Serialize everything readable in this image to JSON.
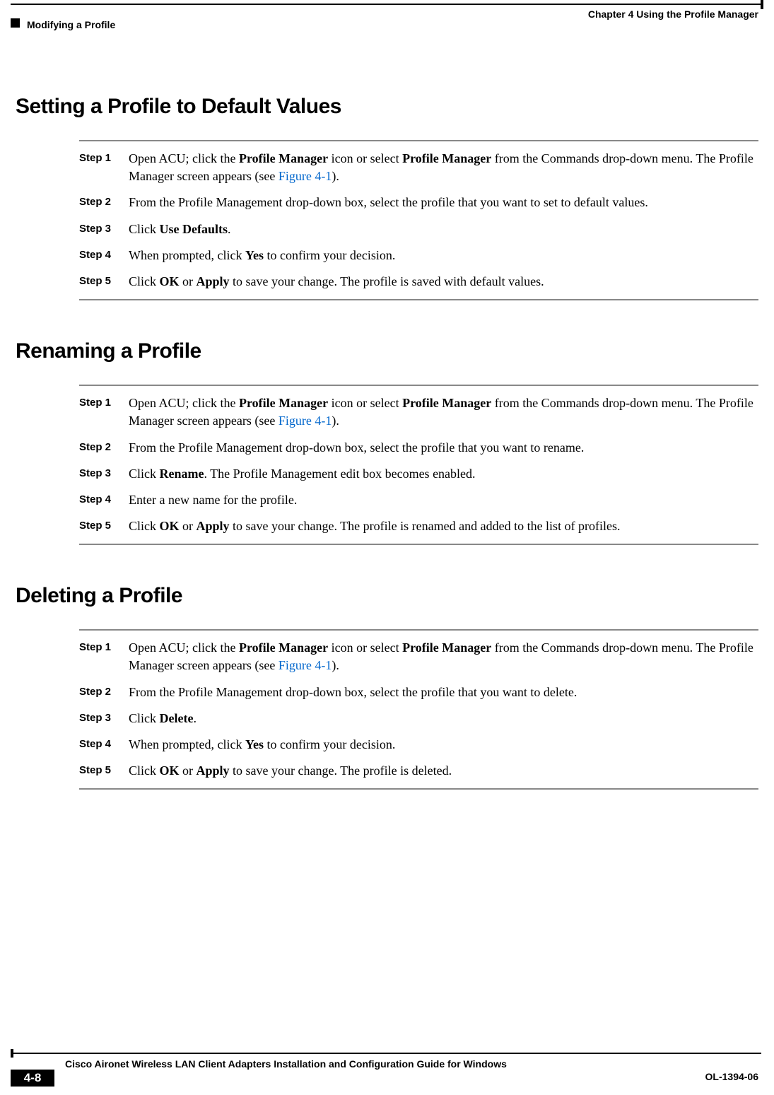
{
  "header": {
    "chapter_label": "Chapter 4      Using the Profile Manager",
    "section_label": "Modifying a Profile"
  },
  "sections": [
    {
      "title": "Setting a Profile to Default Values",
      "steps": [
        {
          "label": "Step 1",
          "parts": [
            {
              "t": "Open ACU; click the "
            },
            {
              "t": "Profile Manager",
              "b": true
            },
            {
              "t": " icon or select "
            },
            {
              "t": "Profile Manager",
              "b": true
            },
            {
              "t": " from the Commands drop-down menu. The Profile Manager screen appears (see "
            },
            {
              "t": "Figure 4-1",
              "link": true
            },
            {
              "t": ")."
            }
          ]
        },
        {
          "label": "Step 2",
          "parts": [
            {
              "t": "From the Profile Management drop-down box, select the profile that you want to set to default values."
            }
          ]
        },
        {
          "label": "Step 3",
          "parts": [
            {
              "t": "Click "
            },
            {
              "t": "Use Defaults",
              "b": true
            },
            {
              "t": "."
            }
          ]
        },
        {
          "label": "Step 4",
          "parts": [
            {
              "t": "When prompted, click "
            },
            {
              "t": "Yes",
              "b": true
            },
            {
              "t": " to confirm your decision."
            }
          ]
        },
        {
          "label": "Step 5",
          "parts": [
            {
              "t": "Click "
            },
            {
              "t": "OK",
              "b": true
            },
            {
              "t": " or "
            },
            {
              "t": "Apply",
              "b": true
            },
            {
              "t": " to save your change. The profile is saved with default values."
            }
          ]
        }
      ]
    },
    {
      "title": "Renaming a Profile",
      "steps": [
        {
          "label": "Step 1",
          "parts": [
            {
              "t": "Open ACU; click the "
            },
            {
              "t": "Profile Manager",
              "b": true
            },
            {
              "t": " icon or select "
            },
            {
              "t": "Profile Manager",
              "b": true
            },
            {
              "t": " from the Commands drop-down menu. The Profile Manager screen appears (see "
            },
            {
              "t": "Figure 4-1",
              "link": true
            },
            {
              "t": ")."
            }
          ]
        },
        {
          "label": "Step 2",
          "parts": [
            {
              "t": "From the Profile Management drop-down box, select the profile that you want to rename."
            }
          ]
        },
        {
          "label": "Step 3",
          "parts": [
            {
              "t": "Click "
            },
            {
              "t": "Rename",
              "b": true
            },
            {
              "t": ". The Profile Management edit box becomes enabled."
            }
          ]
        },
        {
          "label": "Step 4",
          "parts": [
            {
              "t": "Enter a new name for the profile."
            }
          ]
        },
        {
          "label": "Step 5",
          "parts": [
            {
              "t": "Click "
            },
            {
              "t": "OK",
              "b": true
            },
            {
              "t": " or "
            },
            {
              "t": "Apply",
              "b": true
            },
            {
              "t": " to save your change. The profile is renamed and added to the list of profiles."
            }
          ]
        }
      ]
    },
    {
      "title": "Deleting a Profile",
      "steps": [
        {
          "label": "Step 1",
          "parts": [
            {
              "t": "Open ACU; click the "
            },
            {
              "t": "Profile Manager",
              "b": true
            },
            {
              "t": " icon or select "
            },
            {
              "t": "Profile Manager",
              "b": true
            },
            {
              "t": " from the Commands drop-down menu. The Profile Manager screen appears (see "
            },
            {
              "t": "Figure 4-1",
              "link": true
            },
            {
              "t": ")."
            }
          ]
        },
        {
          "label": "Step 2",
          "parts": [
            {
              "t": "From the Profile Management drop-down box, select the profile that you want to delete."
            }
          ]
        },
        {
          "label": "Step 3",
          "parts": [
            {
              "t": "Click "
            },
            {
              "t": "Delete",
              "b": true
            },
            {
              "t": "."
            }
          ]
        },
        {
          "label": "Step 4",
          "parts": [
            {
              "t": "When prompted, click "
            },
            {
              "t": "Yes",
              "b": true
            },
            {
              "t": " to confirm your decision."
            }
          ]
        },
        {
          "label": "Step 5",
          "parts": [
            {
              "t": "Click "
            },
            {
              "t": "OK",
              "b": true
            },
            {
              "t": " or "
            },
            {
              "t": "Apply",
              "b": true
            },
            {
              "t": " to save your change. The profile is deleted."
            }
          ]
        }
      ]
    }
  ],
  "footer": {
    "guide_title": "Cisco Aironet Wireless LAN Client Adapters Installation and Configuration Guide for Windows",
    "page_number": "4-8",
    "doc_id": "OL-1394-06"
  }
}
